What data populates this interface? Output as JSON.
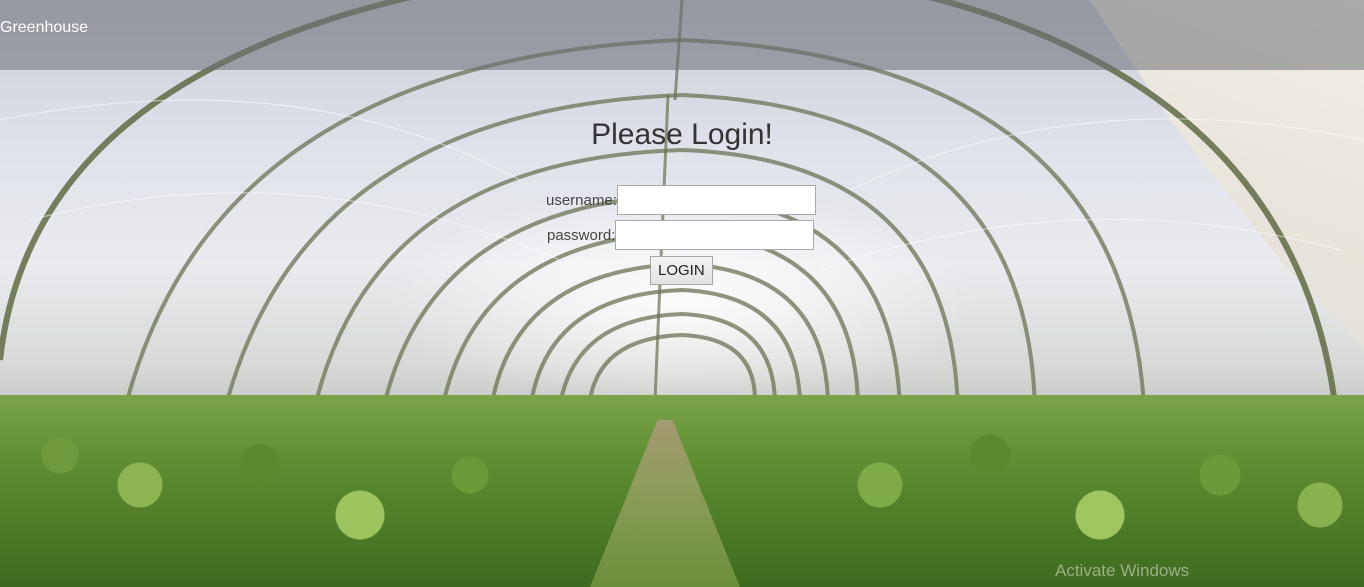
{
  "navbar": {
    "brand": "Greenhouse"
  },
  "login": {
    "title": "Please Login!",
    "username_label": "username:",
    "username_value": "",
    "password_label": "password:",
    "password_value": "",
    "submit_label": "LOGIN"
  },
  "watermark": {
    "text": "Activate Windows"
  }
}
